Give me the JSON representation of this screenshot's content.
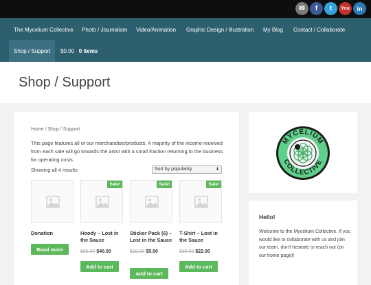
{
  "social": [
    {
      "name": "email",
      "glyph": "✉"
    },
    {
      "name": "facebook",
      "glyph": "f"
    },
    {
      "name": "twitter",
      "glyph": "t"
    },
    {
      "name": "youtube",
      "glyph": "You"
    },
    {
      "name": "linkedin",
      "glyph": "in"
    }
  ],
  "nav": {
    "items": [
      "The Mycelium Collective",
      "Photo / Journalism",
      "Video/Animation",
      "Graphic Design / Illustration",
      "My Blog",
      "Contact / Collaborate",
      "Shop / Support"
    ],
    "cart_total": "$0.00",
    "cart_count": "0 items"
  },
  "page_title": "Shop / Support",
  "breadcrumb": "Home / Shop / Support",
  "intro": "This page features all of our merchandise/products. A majority of the income received from each sale will go towards the artist with a small fraction returning to the business for operating costs.",
  "results": "Showing all 4 results",
  "sort": {
    "selected": "Sort by popularity"
  },
  "products": [
    {
      "title": "Donation",
      "sale": "",
      "old_price": "",
      "price": "",
      "button": "Read more"
    },
    {
      "title": "Hoody – Lost in the Sauce",
      "sale": "Sale!",
      "old_price": "$65.00",
      "price": "$40.00",
      "button": "Add to cart"
    },
    {
      "title": "Sticker Pack (6) – Lost in the Sauce",
      "sale": "Sale!",
      "old_price": "$10.00",
      "price": "$5.00",
      "button": "Add to cart"
    },
    {
      "title": "T-Shirt – Lost in the Sauce",
      "sale": "Sale!",
      "old_price": "$30.00",
      "price": "$22.00",
      "button": "Add to cart"
    }
  ],
  "logo": {
    "top_text": "MYCELIUM",
    "bottom_text": "COLLECTIVE"
  },
  "sidebar": {
    "hello_title": "Hello!",
    "hello_text": "Welcome to the Mycelium Collective. If you would like to collaborate with us and join our team, don't hesitate to reach out (on our home page)!"
  },
  "colors": {
    "nav": "#2e5f6f",
    "accent": "#5cb85c",
    "logo_green": "#5fd08a"
  }
}
